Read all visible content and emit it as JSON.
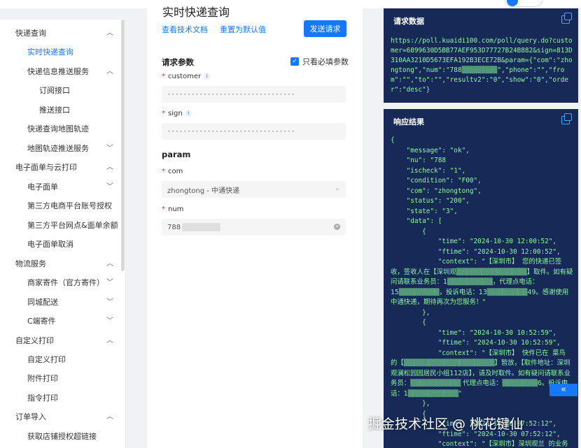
{
  "header": {},
  "sidebar": {
    "items": [
      {
        "label": "快递查询",
        "expanded": true
      },
      {
        "label": "实时快递查询",
        "active": true
      },
      {
        "label": "快递信息推送服务",
        "expanded": true
      },
      {
        "label": "订阅接口"
      },
      {
        "label": "推送接口"
      },
      {
        "label": "快递查询地图轨迹"
      },
      {
        "label": "地图轨迹推送服务",
        "expanded": false
      },
      {
        "label": "电子面单与云打印",
        "expanded": true
      },
      {
        "label": "电子面单",
        "expanded": false
      },
      {
        "label": "第三方电商平台账号授权"
      },
      {
        "label": "第三方平台网点&面单余额"
      },
      {
        "label": "电子面单取消"
      },
      {
        "label": "物流服务",
        "expanded": true
      },
      {
        "label": "商家寄件（官方寄件）",
        "expanded": false
      },
      {
        "label": "同城配送",
        "expanded": false
      },
      {
        "label": "C端寄件",
        "expanded": false
      },
      {
        "label": "自定义打印",
        "expanded": true
      },
      {
        "label": "自定义打印"
      },
      {
        "label": "附件打印"
      },
      {
        "label": "指令打印"
      },
      {
        "label": "订单导入",
        "expanded": true
      },
      {
        "label": "获取店铺授权超链接"
      }
    ]
  },
  "form": {
    "title": "实时快递查询",
    "doc_link": "查看技术文档",
    "reset_link": "重置为默认值",
    "send_button": "发送请求",
    "params_title": "请求参数",
    "required_only": "只看必填参数",
    "customer_label": "customer",
    "customer_mask": "••••••••••••••••••••••••••••••••",
    "sign_label": "sign",
    "sign_mask": "••••••••••••••••••••••••••••••••",
    "param_title": "param",
    "com_label": "com",
    "com_value": "zhongtong - 中通快递",
    "num_label": "num",
    "num_value": "788"
  },
  "request_panel": {
    "title": "请求数据",
    "body": "https://poll.kuaidi100.com/poll/query.do?customer=6899630D5BB77AEF953D77727B24B882&sign=813D310AA3210D5673EFA192B3ECE72B&param={\"com\":\"zhongtong\",\"num\":\"788▒▒▒▒▒▒▒▒▒\",\"phone\":\"\",\"from\":\"\",\"to\":\"\",\"resultv2\":\"0\",\"show\":\"0\",\"order\":\"desc\"}"
  },
  "response_panel": {
    "title": "响应结果",
    "lines": [
      "{",
      "    \"message\": \"ok\",",
      "    \"nu\": \"788",
      "    \"ischeck\": \"1\",",
      "    \"condition\": \"F00\",",
      "    \"com\": \"zhongtong\",",
      "    \"status\": \"200\",",
      "    \"state\": \"3\",",
      "    \"data\": [",
      "        {",
      "            \"time\": \"2024-10-30 12:00:52\",",
      "            \"ftime\": \"2024-10-30 12:00:52\",",
      "            \"context\": \"【深圳市】 您的快递已签"
    ],
    "context1": "收，签收人在【深圳观▒▒▒▒▒▒▒▒▒▒▒▒▒▒】取件。如有疑问请联系业务员：1▒▒▒▒▒▒▒▒▒，代理点电话：15▒▒▒▒▒▒▒▒，投诉电话：13▒▒▒▒▒▒▒▒49。感谢使用中通快递，期待再次为您服务！\"",
    "lines2": [
      "        },",
      "        {",
      "            \"time\": \"2024-10-30 10:52:59\",",
      "            \"ftime\": \"2024-10-30 10:52:59\",",
      "            \"context\": \"【深圳市】 快件已在 菜鸟"
    ],
    "context2": "的【▒▒▒▒▒▒▒▒▒▒▒▒▒▒▒▒▒▒】暂放，【取件地址：深圳观澜松园园居民小组112店】，请及时取件。如有疑问请联系业务员：▒▒▒▒▒▒▒▒▒▒ 代理点电话：▒▒▒▒▒▒▒6。投诉电话：1▒▒▒▒▒▒▒▒▒▒\"",
    "lines3": [
      "        },",
      "        {",
      "            \"time\": \"2024-10-30 07:52:12\",",
      "            \"ftime\": \"2024-10-30 07:52:12\",",
      "            \"context\": \"【深圳市】深圳观兰 的业务"
    ]
  },
  "collapse_label": "«",
  "watermark": "掘金技术社区 @ 桃花键仙"
}
